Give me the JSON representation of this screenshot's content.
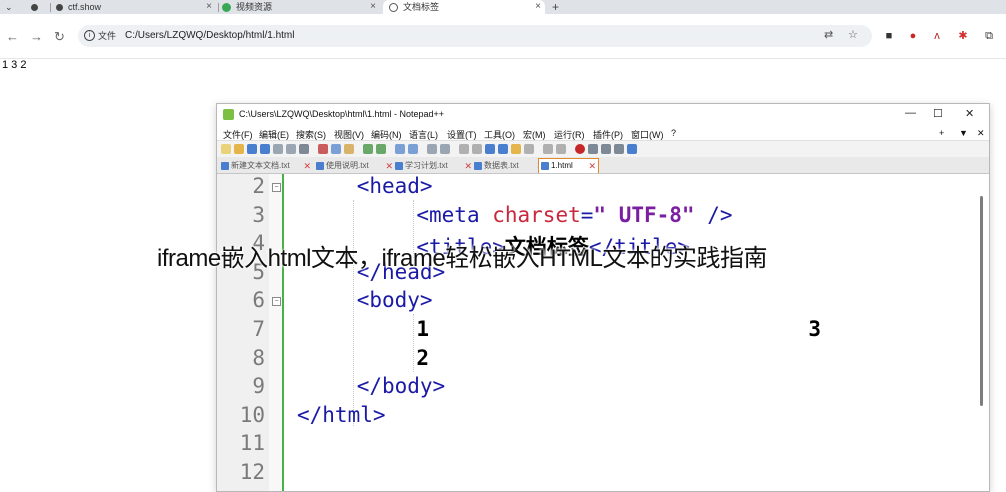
{
  "browser": {
    "tabs": [
      {
        "label": ""
      },
      {
        "label": "ctf.show"
      },
      {
        "label": "视频资源"
      },
      {
        "label": "文档标签"
      }
    ],
    "new_tab": "+",
    "omnibox": {
      "site_info": "文件",
      "url": "C:/Users/LZQWQ/Desktop/html/1.html"
    }
  },
  "page": {
    "body_text": "1 3 2"
  },
  "notepad": {
    "title": "C:\\Users\\LZQWQ\\Desktop\\html\\1.html - Notepad++",
    "window_controls": {
      "minimize": "—",
      "maximize": "☐",
      "close": "✕"
    },
    "menu": [
      "文件(F)",
      "编辑(E)",
      "搜索(S)",
      "视图(V)",
      "编码(N)",
      "语言(L)",
      "设置(T)",
      "工具(O)",
      "宏(M)",
      "运行(R)",
      "插件(P)",
      "窗口(W)",
      "?"
    ],
    "menu_right": [
      "+",
      "▼",
      "✕"
    ],
    "file_tabs": [
      "新建文本文档.txt",
      "使用说明.txt",
      "学习计划.txt",
      "数据表.txt",
      "1.html"
    ],
    "lines": [
      {
        "num": "2",
        "parts": [
          [
            "tag",
            "<head>"
          ]
        ]
      },
      {
        "num": "3",
        "parts": [
          [
            "tag",
            "<meta "
          ],
          [
            "attr",
            "charset"
          ],
          [
            "tag",
            "="
          ],
          [
            "val",
            "\" UTF-8\""
          ],
          [
            "tag",
            " />"
          ]
        ]
      },
      {
        "num": "4",
        "parts": [
          [
            "tag",
            "<title>"
          ],
          [
            "txt",
            "文档标签"
          ],
          [
            "tag",
            "</title>"
          ]
        ]
      },
      {
        "num": "5",
        "parts": [
          [
            "tag",
            "</head>"
          ]
        ]
      },
      {
        "num": "6",
        "parts": [
          [
            "tag",
            "<body>"
          ]
        ]
      },
      {
        "num": "7",
        "parts": [
          [
            "txt",
            "1"
          ],
          [
            "txt",
            "                              3"
          ]
        ]
      },
      {
        "num": "8",
        "parts": [
          [
            "txt",
            "2"
          ]
        ]
      },
      {
        "num": "9",
        "parts": [
          [
            "tag",
            "</body>"
          ]
        ]
      },
      {
        "num": "10",
        "parts": [
          [
            "tag",
            "</html>"
          ]
        ]
      },
      {
        "num": "11",
        "parts": []
      },
      {
        "num": "12",
        "parts": []
      }
    ]
  },
  "overlay_caption": "iframe嵌入html文本，iframe轻松嵌入HTML文本的实践指南"
}
